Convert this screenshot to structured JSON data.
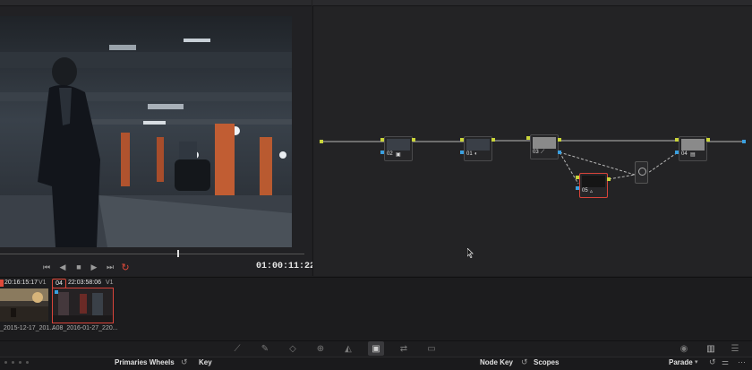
{
  "viewer": {
    "timecode": "01:00:11:22",
    "transport": {
      "prev_icon": "skip-back-icon",
      "back_icon": "play-reverse-icon",
      "stop_icon": "stop-icon",
      "play_icon": "play-icon",
      "next_icon": "skip-forward-icon",
      "loop_icon": "loop-icon"
    }
  },
  "nodes": [
    {
      "id": "02"
    },
    {
      "id": "01"
    },
    {
      "id": "03"
    },
    {
      "id": "04"
    },
    {
      "id": "05"
    }
  ],
  "clips": [
    {
      "number": "",
      "timecode": "20:16:15:17",
      "track": "V1",
      "filename": "_2015-12-17_201..."
    },
    {
      "number": "04",
      "timecode": "22:03:58:06",
      "track": "V1",
      "filename": "A08_2016-01-27_220..."
    }
  ],
  "palette_bar": {
    "primaries_label": "Primaries Wheels",
    "key_label": "Key",
    "node_key_label": "Node Key",
    "scopes_label": "Scopes",
    "parade_label": "Parade"
  },
  "colors": {
    "accent_red": "#e04a3a",
    "node_green": "#c9d43a",
    "node_blue": "#3aa0e0",
    "clip_selected_border": "#d9443a"
  }
}
